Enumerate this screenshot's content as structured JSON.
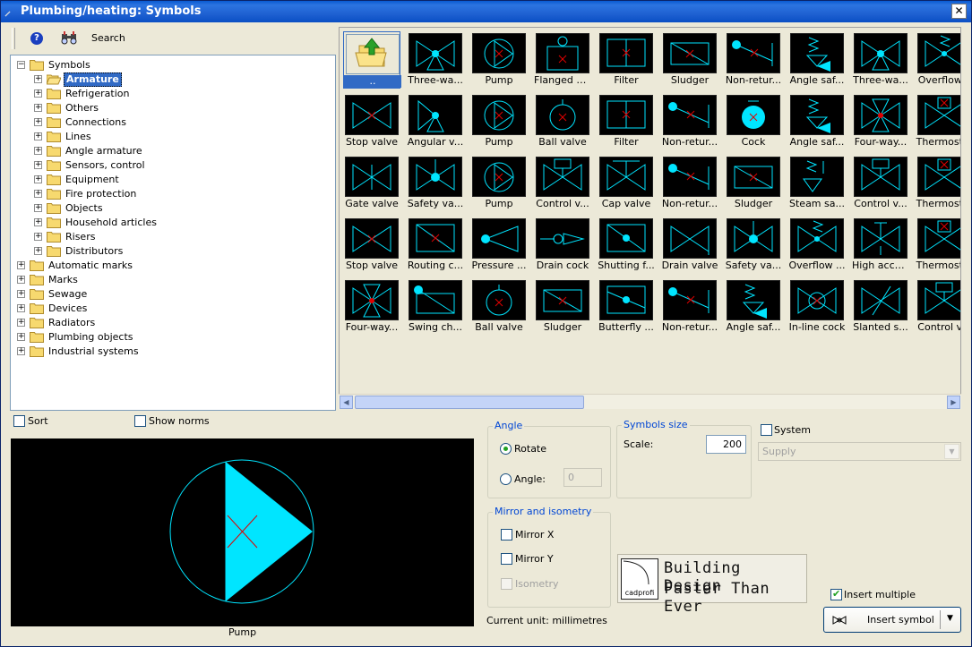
{
  "window": {
    "title": "Plumbing/heating: Symbols"
  },
  "toolbar": {
    "search_label": "Search"
  },
  "tree": {
    "items": [
      {
        "label": "Symbols",
        "level": 0,
        "expanded": true,
        "selected": false
      },
      {
        "label": "Armature",
        "level": 1,
        "expanded": false,
        "selected": true
      },
      {
        "label": "Refrigeration",
        "level": 1,
        "expanded": false,
        "selected": false
      },
      {
        "label": "Others",
        "level": 1,
        "expanded": false,
        "selected": false
      },
      {
        "label": "Connections",
        "level": 1,
        "expanded": false,
        "selected": false
      },
      {
        "label": "Lines",
        "level": 1,
        "expanded": false,
        "selected": false
      },
      {
        "label": "Angle armature",
        "level": 1,
        "expanded": false,
        "selected": false
      },
      {
        "label": "Sensors, control",
        "level": 1,
        "expanded": false,
        "selected": false
      },
      {
        "label": "Equipment",
        "level": 1,
        "expanded": false,
        "selected": false
      },
      {
        "label": "Fire protection",
        "level": 1,
        "expanded": false,
        "selected": false
      },
      {
        "label": "Objects",
        "level": 1,
        "expanded": false,
        "selected": false
      },
      {
        "label": "Household articles",
        "level": 1,
        "expanded": false,
        "selected": false
      },
      {
        "label": "Risers",
        "level": 1,
        "expanded": false,
        "selected": false
      },
      {
        "label": "Distributors",
        "level": 1,
        "expanded": false,
        "selected": false
      },
      {
        "label": "Automatic marks",
        "level": 0,
        "expanded": false,
        "selected": false
      },
      {
        "label": "Marks",
        "level": 0,
        "expanded": false,
        "selected": false
      },
      {
        "label": "Sewage",
        "level": 0,
        "expanded": false,
        "selected": false
      },
      {
        "label": "Devices",
        "level": 0,
        "expanded": false,
        "selected": false
      },
      {
        "label": "Radiators",
        "level": 0,
        "expanded": false,
        "selected": false
      },
      {
        "label": "Plumbing objects",
        "level": 0,
        "expanded": false,
        "selected": false
      },
      {
        "label": "Industrial systems",
        "level": 0,
        "expanded": false,
        "selected": false
      }
    ]
  },
  "symbols": {
    "rows": [
      [
        {
          "caption": "..",
          "icon": "folder-up-icon"
        },
        {
          "caption": "Three-wa...",
          "icon": "three-way-valve-icon"
        },
        {
          "caption": "Pump",
          "icon": "pump-icon"
        },
        {
          "caption": "Flanged b...",
          "icon": "flanged-valve-icon"
        },
        {
          "caption": "Filter",
          "icon": "filter-icon"
        },
        {
          "caption": "Sludger",
          "icon": "sludger-icon"
        },
        {
          "caption": "Non-retur...",
          "icon": "non-return-valve-icon"
        },
        {
          "caption": "Angle saf...",
          "icon": "angle-safety-valve-icon"
        },
        {
          "caption": "Three-wa...",
          "icon": "three-way-valve-icon"
        },
        {
          "caption": "Overflow...",
          "icon": "overflow-valve-icon"
        }
      ],
      [
        {
          "caption": "Stop valve",
          "icon": "stop-valve-icon"
        },
        {
          "caption": "Angular v...",
          "icon": "angular-valve-icon"
        },
        {
          "caption": "Pump",
          "icon": "pump-icon"
        },
        {
          "caption": "Ball valve",
          "icon": "ball-valve-icon"
        },
        {
          "caption": "Filter",
          "icon": "filter-icon"
        },
        {
          "caption": "Non-retur...",
          "icon": "non-return-valve-icon"
        },
        {
          "caption": "Cock",
          "icon": "cock-icon"
        },
        {
          "caption": "Angle saf...",
          "icon": "angle-safety-valve-icon"
        },
        {
          "caption": "Four-way...",
          "icon": "four-way-valve-icon"
        },
        {
          "caption": "Thermost...",
          "icon": "thermostatic-valve-icon"
        }
      ],
      [
        {
          "caption": "Gate valve",
          "icon": "gate-valve-icon"
        },
        {
          "caption": "Safety va...",
          "icon": "safety-valve-icon"
        },
        {
          "caption": "Pump",
          "icon": "pump-icon"
        },
        {
          "caption": "Control v...",
          "icon": "control-valve-icon"
        },
        {
          "caption": "Cap valve",
          "icon": "cap-valve-icon"
        },
        {
          "caption": "Non-retur...",
          "icon": "non-return-valve-icon"
        },
        {
          "caption": "Sludger",
          "icon": "sludger-icon"
        },
        {
          "caption": "Steam sa...",
          "icon": "steam-safety-valve-icon"
        },
        {
          "caption": "Control v...",
          "icon": "control-valve-icon"
        },
        {
          "caption": "Thermost...",
          "icon": "thermostatic-valve-icon"
        }
      ],
      [
        {
          "caption": "Stop valve",
          "icon": "stop-valve-icon"
        },
        {
          "caption": "Routing c...",
          "icon": "routing-cock-icon"
        },
        {
          "caption": "Pressure ...",
          "icon": "pressure-valve-icon"
        },
        {
          "caption": "Drain cock",
          "icon": "drain-cock-icon"
        },
        {
          "caption": "Shutting f...",
          "icon": "shutting-flap-icon"
        },
        {
          "caption": "Drain valve",
          "icon": "drain-valve-icon"
        },
        {
          "caption": "Safety va...",
          "icon": "safety-valve-icon"
        },
        {
          "caption": "Overflow ...",
          "icon": "overflow-valve-icon"
        },
        {
          "caption": "High accu...",
          "icon": "high-accuracy-valve-icon"
        },
        {
          "caption": "Thermost...",
          "icon": "thermostatic-valve-icon"
        }
      ],
      [
        {
          "caption": "Four-way...",
          "icon": "four-way-valve-icon"
        },
        {
          "caption": "Swing ch...",
          "icon": "swing-check-valve-icon"
        },
        {
          "caption": "Ball valve",
          "icon": "ball-valve-icon"
        },
        {
          "caption": "Sludger",
          "icon": "sludger-icon"
        },
        {
          "caption": "Butterfly ...",
          "icon": "butterfly-valve-icon"
        },
        {
          "caption": "Non-retur...",
          "icon": "non-return-valve-icon"
        },
        {
          "caption": "Angle saf...",
          "icon": "angle-safety-valve-icon"
        },
        {
          "caption": "In-line cock",
          "icon": "in-line-cock-icon"
        },
        {
          "caption": "Slanted s...",
          "icon": "slanted-valve-icon"
        },
        {
          "caption": "Control v...",
          "icon": "control-valve-icon"
        }
      ]
    ]
  },
  "options": {
    "sort_label": "Sort",
    "sort_checked": false,
    "show_norms_label": "Show norms",
    "show_norms_checked": false
  },
  "preview": {
    "caption": "Pump"
  },
  "angle": {
    "title": "Angle",
    "rotate_label": "Rotate",
    "angle_label": "Angle:",
    "angle_value": "0",
    "rotate_selected": true
  },
  "symbols_size": {
    "title": "Symbols size",
    "scale_label": "Scale:",
    "scale_value": "200"
  },
  "system": {
    "label": "System",
    "checked": false,
    "selected_value": "Supply"
  },
  "mirror": {
    "title": "Mirror and isometry",
    "mirror_x_label": "Mirror X",
    "mirror_y_label": "Mirror Y",
    "isometry_label": "Isometry"
  },
  "logo": {
    "brand": "cadprofi",
    "line1": "Building Design",
    "line2": "Faster Than Ever"
  },
  "status": {
    "current_unit": "Current unit: millimetres"
  },
  "insert": {
    "multiple_label": "Insert multiple",
    "multiple_checked": true,
    "button_label": "Insert symbol"
  },
  "colors": {
    "title_bar": "#1f61d2",
    "symbol_cyan": "#00e5ff",
    "symbol_red": "#e00000",
    "selection": "#316ac5"
  }
}
